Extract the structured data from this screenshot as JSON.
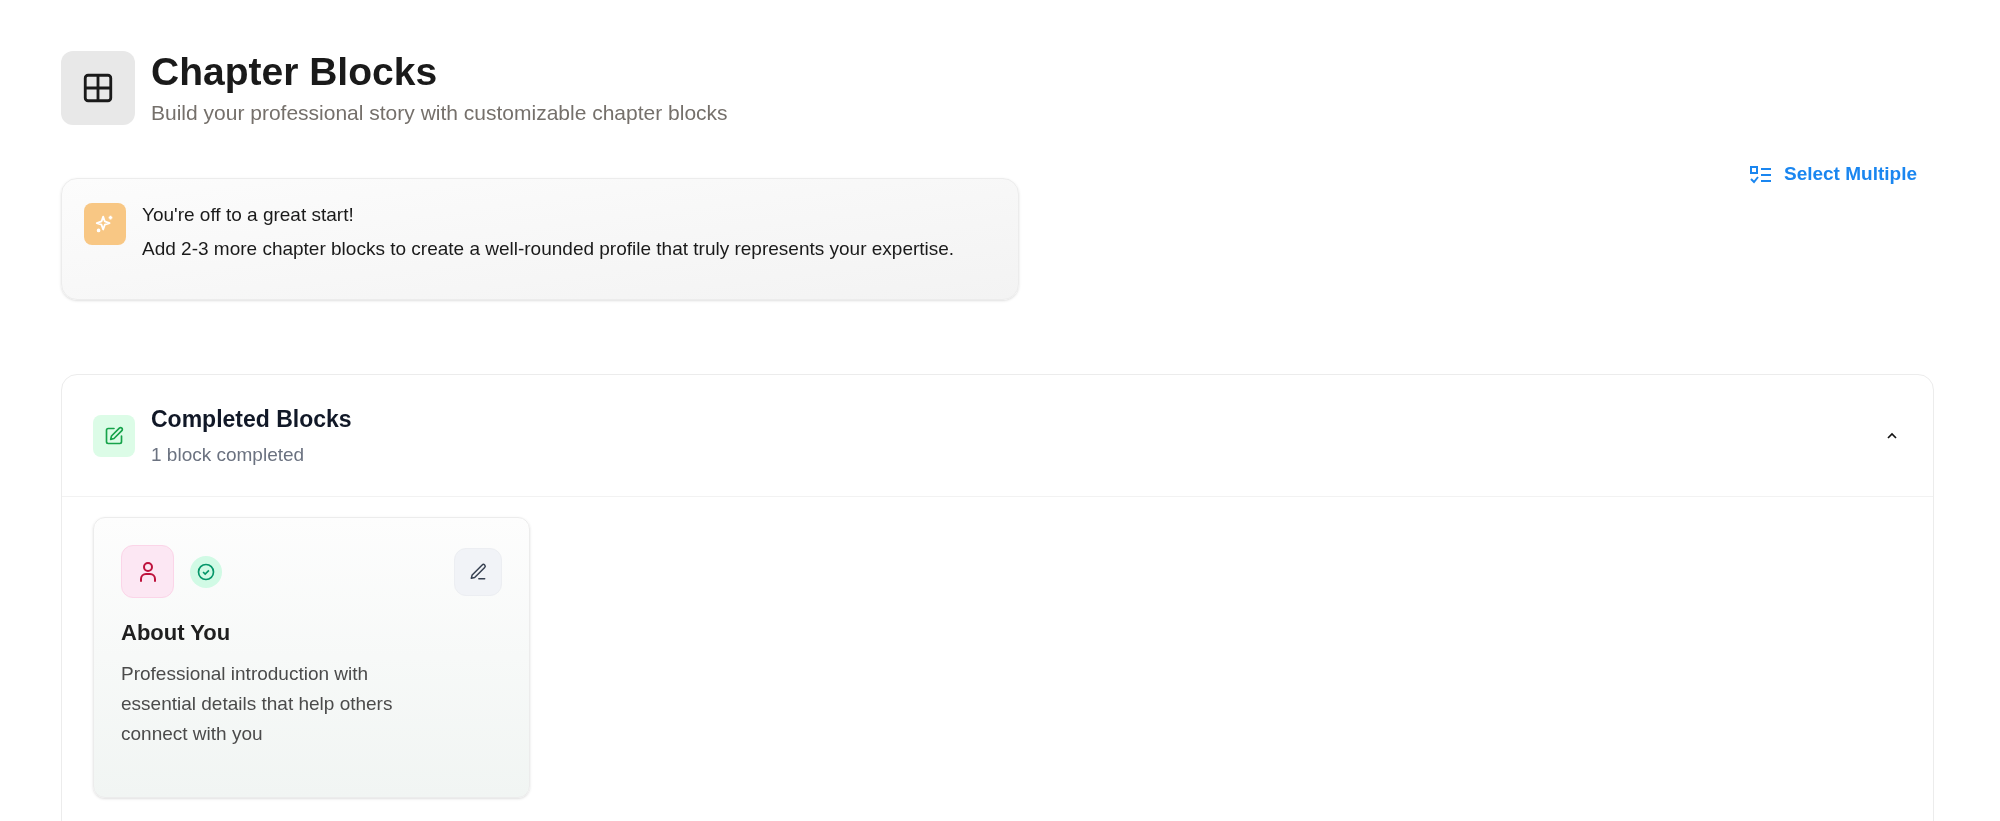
{
  "header": {
    "title": "Chapter Blocks",
    "subtitle": "Build your professional story with customizable chapter blocks"
  },
  "toolbar": {
    "select_multiple": "Select Multiple"
  },
  "notice": {
    "title": "You're off to a great start!",
    "message": "Add 2-3 more chapter blocks to create a well-rounded profile that truly represents your expertise."
  },
  "section": {
    "title": "Completed Blocks",
    "subtitle": "1 block completed",
    "expanded": true,
    "blocks": [
      {
        "title": "About You",
        "description": "Professional introduction with essential details that help others connect with you",
        "completed": true
      }
    ]
  }
}
